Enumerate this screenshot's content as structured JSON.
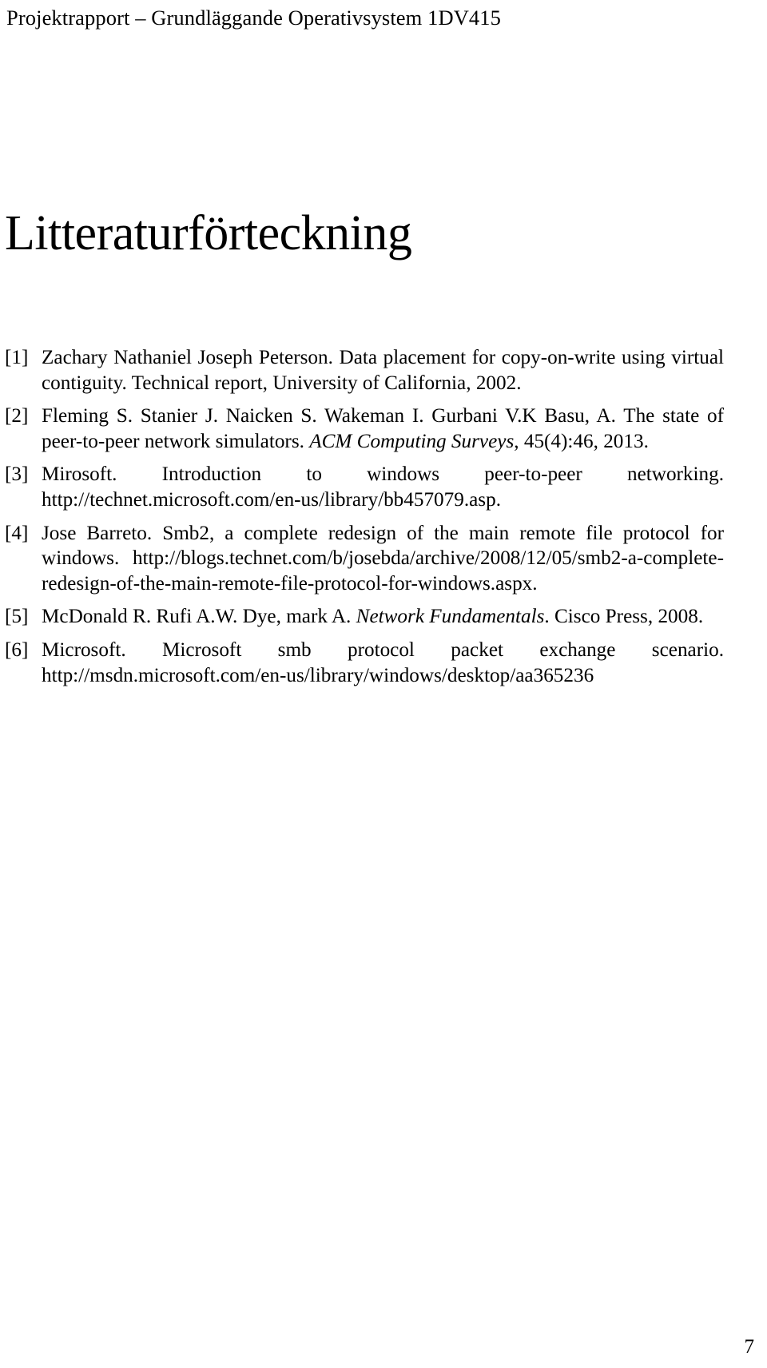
{
  "document": {
    "running_header": "Projektrapport – Grundläggande Operativsystem 1DV415",
    "chapter_title": "Litteraturförteckning",
    "page_number": "7",
    "text_color": "#000000",
    "background_color": "#ffffff"
  },
  "bibliography": {
    "entries": [
      {
        "label": "[1]",
        "authors": "Zachary Nathaniel Joseph Peterson.",
        "title": "Data placement for copy-on-write using virtual contiguity.",
        "publication": "",
        "rest": "Technical report, University of California, 2002.",
        "full_text": "Zachary Nathaniel Joseph Peterson. Data placement for copy-on-write using virtual contiguity. Technical report, University of California, 2002."
      },
      {
        "label": "[2]",
        "authors": "Fleming S. Stanier J. Naicken S. Wakeman I. Gurbani V.K Basu, A.",
        "title": "The state of peer-to-peer network simulators.",
        "publication": "ACM Computing Surveys",
        "rest": ", 45(4):46, 2013.",
        "full_text": "Fleming S. Stanier J. Naicken S. Wakeman I. Gurbani V.K Basu, A. The state of peer-to-peer network simulators. ACM Computing Surveys, 45(4):46, 2013."
      },
      {
        "label": "[3]",
        "authors": "Mirosoft.",
        "title": "Introduction to windows peer-to-peer networking.",
        "publication": "",
        "rest": "http://technet.microsoft.com/en-us/library/bb457079.asp.",
        "full_text": "Mirosoft. Introduction to windows peer-to-peer networking. http://technet.microsoft.com/en-us/library/bb457079.asp."
      },
      {
        "label": "[4]",
        "authors": "Jose Barreto.",
        "title": "Smb2, a complete redesign of the main remote file protocol for windows.",
        "publication": "",
        "rest": "http://blogs.technet.com/b/josebda/archive/2008/12/05/smb2-a-complete-redesign-of-the-main-remote-file-protocol-for-windows.aspx.",
        "full_text": "Jose Barreto. Smb2, a complete redesign of the main remote file protocol for windows. http://blogs.technet.com/b/josebda/archive/2008/12/05/smb2-a-complete-redesign-of-the-main-remote-file-protocol-for-windows.aspx."
      },
      {
        "label": "[5]",
        "authors": "McDonald R. Rufi A.W. Dye, mark A.",
        "title": "",
        "publication": "Network Fundamentals",
        "rest": ". Cisco Press, 2008.",
        "full_text": "McDonald R. Rufi A.W. Dye, mark A. Network Fundamentals. Cisco Press, 2008."
      },
      {
        "label": "[6]",
        "authors": "Microsoft.",
        "title": "Microsoft smb protocol packet exchange scenario.",
        "publication": "",
        "rest": "http://msdn.microsoft.com/en-us/library/windows/desktop/aa365236",
        "full_text": "Microsoft. Microsoft smb protocol packet exchange scenario. http://msdn.microsoft.com/en-us/library/windows/desktop/aa365236"
      }
    ]
  }
}
